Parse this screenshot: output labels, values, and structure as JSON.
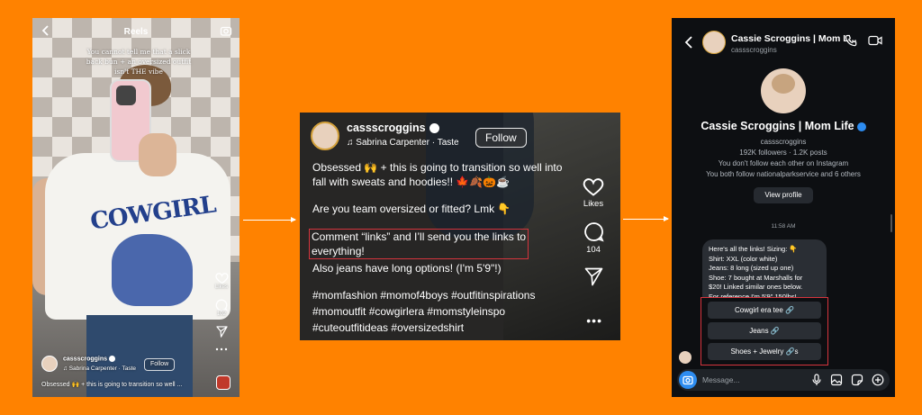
{
  "colors": {
    "background": "#FF8200",
    "highlight": "#D6343D",
    "accent": "#2D8CF0"
  },
  "reel": {
    "header_title": "Reels",
    "overlay_text": "You cannot tell me that a slick back bun + an oversized outfit isn't THE vibe",
    "username": "cassscroggins",
    "audio": "Sabrina Carpenter · Taste",
    "follow_label": "Follow",
    "caption": "Obsessed 🙌 + this is going to transition so well ...",
    "likes_label": "Likes",
    "comment_count": "102",
    "shirt_graphic_text": "COWGIRL",
    "icons": [
      "back-icon",
      "camera-icon",
      "heart-icon",
      "comment-icon",
      "send-icon",
      "more-icon"
    ]
  },
  "caption_view": {
    "username": "cassscroggins",
    "audio": "Sabrina Carpenter · Taste",
    "follow_label": "Follow",
    "para1": "Obsessed 🙌 + this is going to transition so well into fall with sweats and hoodies!! 🍁🍂🎃☕",
    "para2": "Are you team oversized or fitted? Lmk 👇",
    "highlight_line1": "Comment “links” and I’ll send you the links to",
    "highlight_line2": "everything!",
    "para3": "Also jeans have long options! (I'm 5'9\"!)",
    "hashtags1": "#momfashion #momof4boys #outfitinspirations",
    "hashtags2": "#momoutfit #cowgirlera #momstyleinspo",
    "hashtags3": "#cuteoutfitideas #oversizedshirt",
    "likes_label": "Likes",
    "comment_count": "104",
    "more": "•••"
  },
  "dm": {
    "header_name": "Cassie Scroggins | Mom L...",
    "header_handle": "cassscroggins",
    "profile_name": "Cassie Scroggins | Mom Life",
    "profile_handle": "cassscroggins",
    "stats": "192K followers · 1.2K posts",
    "follow_status": "You don't follow each other on Instagram",
    "mutuals": "You both follow nationalparkservice and 6 others",
    "view_profile_label": "View profile",
    "timestamp": "11:58 AM",
    "message_lines": [
      "Here's all the links! Sizing: 👇",
      "Shirt: XXL (color white)",
      "Jeans: 8 long (sized up one)",
      "Shoe: 7 bought at Marshalls for",
      "$20! Linked similar ones below.",
      "For reference I'm 5'9\" 150lbs!"
    ],
    "link_buttons": [
      "Cowgirl era tee 🔗",
      "Jeans 🔗",
      "Shoes + Jewelry 🔗s"
    ],
    "composer_placeholder": "Message..."
  }
}
